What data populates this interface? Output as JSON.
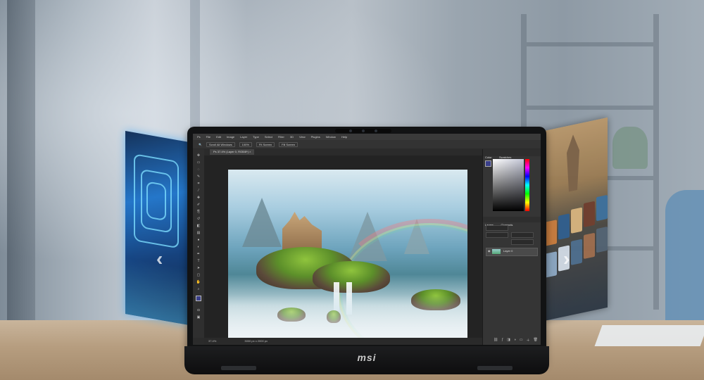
{
  "photoshop": {
    "menu": [
      "Ps",
      "File",
      "Edit",
      "Image",
      "Layer",
      "Type",
      "Select",
      "Filter",
      "3D",
      "View",
      "Plugins",
      "Window",
      "Help"
    ],
    "options": {
      "scroll_all_windows": "Scroll All Windows",
      "zoom_value": "100%",
      "fit_screen": "Fit Screen",
      "fill_screen": "Fill Screen"
    },
    "document_tab": "Ps 37.4% (Layer 0, RGB/8*) ×",
    "panels": {
      "color_tabs": [
        "Color",
        "Swatches"
      ],
      "layers_tabs": [
        "Layers",
        "Channels"
      ],
      "layer_name": "Layer 0"
    },
    "status": {
      "zoom": "37.4%",
      "doc": "3000 px x 2000 px"
    }
  },
  "device": {
    "brand": "msi"
  },
  "colors": {
    "ps_dark": "#2b2b2b",
    "panel_left_glow": "#1c72c9",
    "desk": "#b69d7f"
  }
}
